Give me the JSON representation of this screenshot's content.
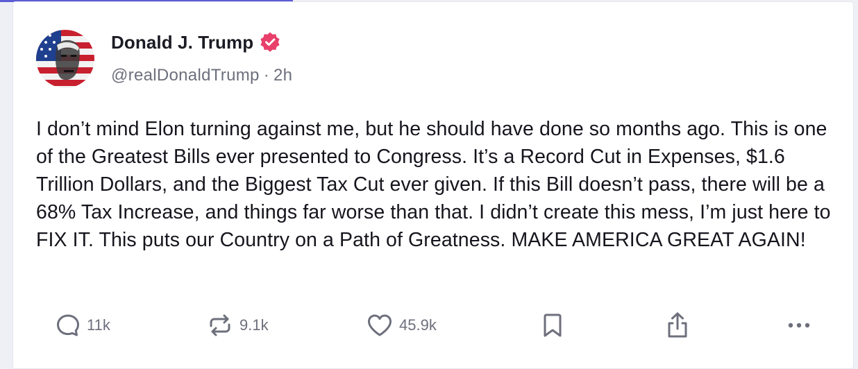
{
  "post": {
    "author": {
      "display_name": "Donald J. Trump",
      "handle": "@realDonaldTrump",
      "verified": true,
      "avatar_icon": "avatar-flag-portrait"
    },
    "time_ago": "2h",
    "separator": "·",
    "text": "I don’t mind Elon turning against me, but he should have done so months ago. This is one of the Greatest Bills ever presented to Congress. It’s a Record Cut in Expenses, $1.6 Trillion Dollars, and the Biggest Tax Cut ever given. If this Bill doesn’t pass, there will be a 68% Tax Increase, and things far worse than that. I didn’t create this mess, I’m just here to FIX IT. This puts our Country on a Path of Greatness. MAKE AMERICA GREAT AGAIN!"
  },
  "actions": {
    "reply": {
      "icon": "reply-icon",
      "count": "11k"
    },
    "repost": {
      "icon": "repost-icon",
      "count": "9.1k"
    },
    "like": {
      "icon": "heart-icon",
      "count": "45.9k"
    },
    "bookmark": {
      "icon": "bookmark-icon"
    },
    "share": {
      "icon": "share-icon"
    },
    "more": {
      "icon": "more-icon"
    }
  },
  "colors": {
    "accent": "#5b5bd6",
    "verified_badge": "#e8406b",
    "text_primary": "#15151d",
    "text_secondary": "#6d6f7c",
    "background": "#eef0f6",
    "card": "#ffffff"
  }
}
